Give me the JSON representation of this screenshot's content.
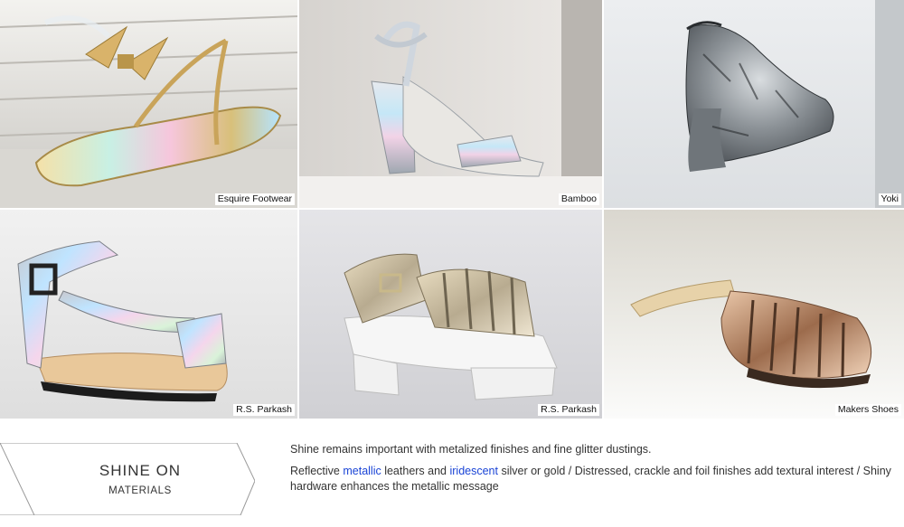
{
  "photos": [
    {
      "credit": "Esquire Footwear",
      "subject": "gold holographic bow thong sandal"
    },
    {
      "credit": "Bamboo",
      "subject": "iridescent ankle strap wedge sandal"
    },
    {
      "credit": "Yoki",
      "subject": "crackle silver platform wedge bootie"
    },
    {
      "credit": "R.S. Parkash",
      "subject": "iridescent T-strap flat sandal"
    },
    {
      "credit": "R.S. Parkash",
      "subject": "silver glitter fisherman platform sandal"
    },
    {
      "credit": "Makers Shoes",
      "subject": "rose gold metallic fisherman flat"
    }
  ],
  "section": {
    "title": "SHINE ON",
    "subtitle": "MATERIALS"
  },
  "copy": {
    "line1": "Shine remains important with metalized finishes and fine glitter dustings.",
    "p2_part1": "Reflective ",
    "p2_link1": "metallic",
    "p2_part2": " leathers and ",
    "p2_link2": "iridescent",
    "p2_part3": " silver or gold / Distressed, crackle and foil finishes add textural interest / Shiny hardware enhances the metallic message"
  },
  "colors": {
    "highlight": "#1a44d6",
    "text": "#333333"
  }
}
